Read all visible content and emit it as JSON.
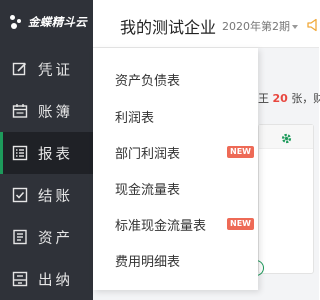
{
  "app": {
    "logo_text": "金蝶精斗云"
  },
  "sidebar": {
    "items": [
      {
        "label": "凭证",
        "icon": "edit-icon"
      },
      {
        "label": "账簿",
        "icon": "calendar-icon"
      },
      {
        "label": "报表",
        "icon": "report-icon",
        "active": true
      },
      {
        "label": "结账",
        "icon": "checkbox-icon"
      },
      {
        "label": "资产",
        "icon": "asset-icon"
      },
      {
        "label": "出纳",
        "icon": "cash-icon"
      }
    ]
  },
  "header": {
    "company": "我的测试企业",
    "period": "2020年第2期"
  },
  "notice": {
    "prefix": "王",
    "count": "20",
    "suffix": "张，财务"
  },
  "dropdown": {
    "items": [
      {
        "label": "资产负债表"
      },
      {
        "label": "利润表"
      },
      {
        "label": "部门利润表",
        "badge": "NEW"
      },
      {
        "label": "现金流量表"
      },
      {
        "label": "标准现金流量表",
        "badge": "NEW"
      },
      {
        "label": "费用明细表"
      }
    ]
  },
  "colors": {
    "sidebar_bg": "#2f3239",
    "accent_green": "#1d9a5b",
    "badge_red": "#ee6a56",
    "number_red": "#e8473f"
  }
}
